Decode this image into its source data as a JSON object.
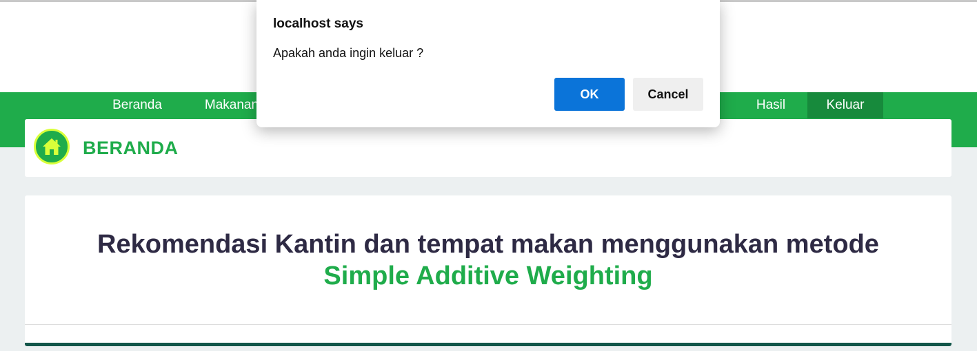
{
  "nav": {
    "items": [
      {
        "label": "Beranda"
      },
      {
        "label": "Makanan"
      },
      {
        "label": "Hasil"
      },
      {
        "label": "Keluar"
      }
    ],
    "active": "Keluar"
  },
  "section": {
    "title": "BERANDA",
    "icon": "home-icon"
  },
  "main": {
    "headline_part1": "Rekomendasi Kantin dan tempat makan menggunakan metode",
    "headline_part2": "Simple Additive Weighting"
  },
  "dialog": {
    "title": "localhost says",
    "message": "Apakah anda ingin keluar ?",
    "ok_label": "OK",
    "cancel_label": "Cancel"
  },
  "colors": {
    "brand_green": "#1fac4b",
    "active_nav": "#178a3c",
    "ok_blue": "#0b74d9",
    "headline_dark": "#2e2a44",
    "badge_ring": "#d9ff3a"
  }
}
